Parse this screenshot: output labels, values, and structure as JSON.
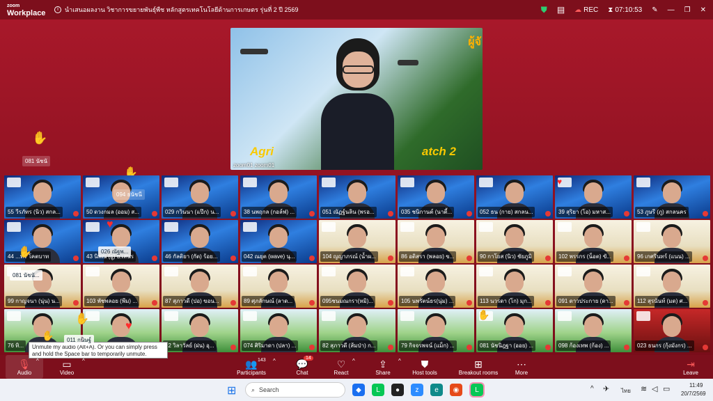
{
  "titlebar": {
    "app_small": "zoom",
    "app_name": "Workplace",
    "meeting_title": "นำเสนอผลงาน วิชาการขยายพันธุ์พืช หลักสูตรเทคโนโลยีด้านการเกษตร รุ่นที่ 2 ปี 2569",
    "rec": "REC",
    "timer": "07:10:53"
  },
  "speaker": {
    "name": "zoom01 zoom01",
    "banner_left": "Agri",
    "banner_right": "atch 2",
    "corner": "ผู้จั"
  },
  "floating": [
    {
      "text": "081 นัชนั"
    },
    {
      "text": "094 ธนัชนี"
    },
    {
      "text": "026 ณัฐพ..."
    },
    {
      "text": "081 นัชนั..."
    },
    {
      "text": "011 กนิษฐ์"
    }
  ],
  "tiles": [
    {
      "label": "55 วีรภัทร (นิว) สกล...",
      "bg": "blue"
    },
    {
      "label": "50 ดวงกมล (ออม) ส...",
      "bg": "blue"
    },
    {
      "label": "029 กวินนา (แป๊ก) น...",
      "bg": "blue"
    },
    {
      "label": "38 นพฤกล (กอล์ฟ) ...",
      "bg": "blue"
    },
    {
      "label": "051 ณัฏฐ์นลิน (พรอ...",
      "bg": "blue"
    },
    {
      "label": "035 ชนิกานต์ (นาตี้...",
      "bg": "blue"
    },
    {
      "label": "052 ธน (กาย) สกลน...",
      "bg": "blue"
    },
    {
      "label": "39 สุริยา (โอ) มหาส...",
      "bg": "blue"
    },
    {
      "label": "53 ภูษรี (ภู) สกลนคร",
      "bg": "blue"
    },
    {
      "label": "44 ...ทร โคตบาท",
      "bg": "blue"
    },
    {
      "label": "43 นิพณ (ยู) ย.เสนร",
      "bg": "blue"
    },
    {
      "label": "46 กัลติยา (กัต) ร้อย...",
      "bg": "blue"
    },
    {
      "label": "042 ณยุต (wave) นุ...",
      "bg": "blue"
    },
    {
      "label": "104 ญญาภรณ์ (น้ำผ...",
      "bg": "cream"
    },
    {
      "label": "86 อติสรา (พลอย) ข...",
      "bg": "cream"
    },
    {
      "label": "90 กาโยส (นิว) ชัยภูมิ",
      "bg": "cream"
    },
    {
      "label": "102 พรรกร (น็อต) ขั...",
      "bg": "cream"
    },
    {
      "label": "96 เกศรินทร์ (แนน) ...",
      "bg": "cream"
    },
    {
      "label": "99 กาญจนา (นุ่น) น...",
      "bg": "cream"
    },
    {
      "label": "103 พัชพลอย (พีม) ...",
      "bg": "cream"
    },
    {
      "label": "87 สุภาวดี (ปอ) ขอน...",
      "bg": "cream"
    },
    {
      "label": "89 ศุภลักษณ์ (ลาด...",
      "bg": "cream"
    },
    {
      "label": "095ชนมณกรา(หมิ)...",
      "bg": "cream"
    },
    {
      "label": "105 นพรัตน์ธร(นุ่ม) ...",
      "bg": "cream"
    },
    {
      "label": "113 นวรดา (โก) มุก...",
      "bg": "cream"
    },
    {
      "label": "091 ดาวประกาย (ดา...",
      "bg": "cream"
    },
    {
      "label": "112 สุรนันท์ (มด) ศ...",
      "bg": "cream"
    },
    {
      "label": "76 ทิ...",
      "bg": "green"
    },
    {
      "label": "",
      "bg": "green"
    },
    {
      "label": "72 วิลาวัลย์ (ฝน) อุ...",
      "bg": "green"
    },
    {
      "label": "074 ศิริมาดา (ปลา) ...",
      "bg": "green"
    },
    {
      "label": "82 สุภาวดี (ส้มป่า) ก...",
      "bg": "green"
    },
    {
      "label": "79 กิจจรพจน์ (แม็ก) ...",
      "bg": "green"
    },
    {
      "label": "081 นัชนิฎฐา (ออย) ...",
      "bg": "green"
    },
    {
      "label": "098 ก้องเทพ (ก้อง) ...",
      "bg": "green"
    },
    {
      "label": "023 ธนกร (กุ้งมังกร) ...",
      "bg": "red"
    }
  ],
  "tooltip": "Unmute my audio (Alt+A). Or you can simply press and hold the Space bar to temporarily unmute.",
  "toolbar": {
    "audio": "Audio",
    "video": "Video",
    "participants": "Participants",
    "participants_count": "143",
    "chat": "Chat",
    "chat_badge": "14",
    "react": "React",
    "share": "Share",
    "host_tools": "Host tools",
    "breakout": "Breakout rooms",
    "more": "More",
    "leave": "Leave"
  },
  "taskbar": {
    "search": "Search",
    "lang": "ไทย",
    "time": "11:49",
    "date": "20/7/2569"
  }
}
